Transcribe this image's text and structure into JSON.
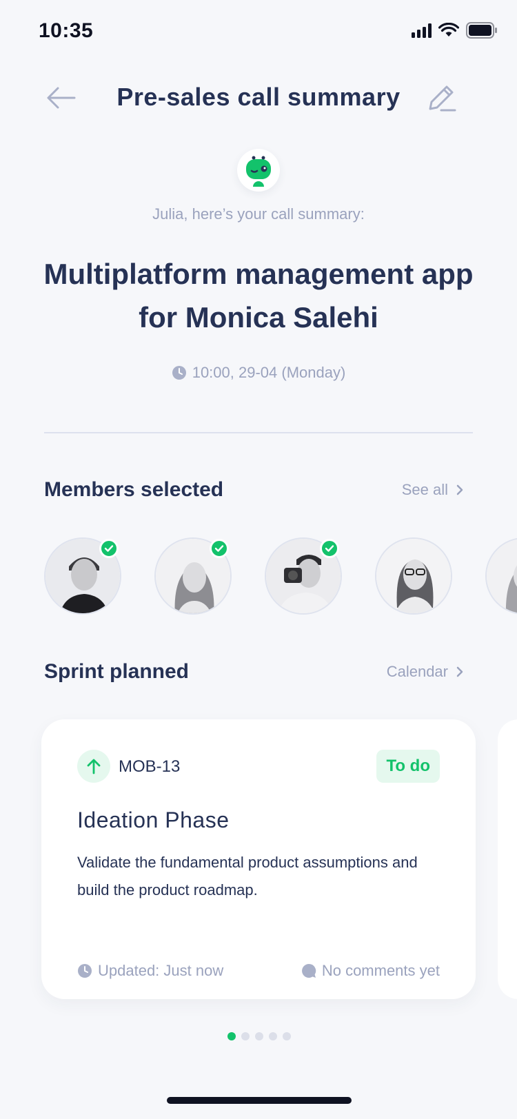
{
  "status_bar": {
    "time": "10:35"
  },
  "header": {
    "title": "Pre-sales call summary"
  },
  "assistant": {
    "greeting": "Julia, here’s your call summary:"
  },
  "call": {
    "title": "Multiplatform management app for Monica Salehi",
    "datetime": "10:00, 29-04 (Monday)"
  },
  "members_section": {
    "title": "Members selected",
    "link_label": "See all",
    "members": [
      {
        "selected": true
      },
      {
        "selected": true
      },
      {
        "selected": true
      },
      {
        "selected": false
      },
      {
        "selected": false
      }
    ]
  },
  "sprint_section": {
    "title": "Sprint planned",
    "link_label": "Calendar"
  },
  "task_card": {
    "id": "MOB-13",
    "status": "To do",
    "title": "Ideation Phase",
    "description": "Validate the fundamental product assumptions and build the product roadmap.",
    "updated": "Updated: Just now",
    "comments": "No comments yet"
  },
  "pager": {
    "count": 5,
    "active_index": 0
  },
  "colors": {
    "accent": "#13c26b",
    "text": "#263255",
    "muted": "#9aa2bd",
    "background": "#f6f7fa"
  }
}
